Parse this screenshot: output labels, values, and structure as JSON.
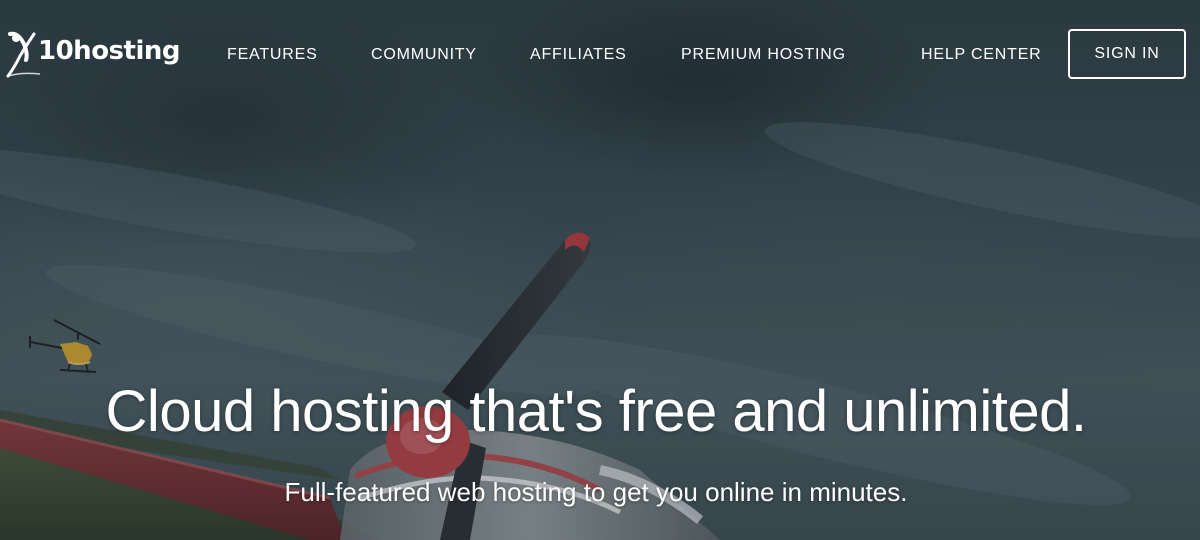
{
  "brand": {
    "name": "10hosting",
    "accent_color": "#ffffff"
  },
  "nav": {
    "items": [
      {
        "label": "FEATURES"
      },
      {
        "label": "COMMUNITY"
      },
      {
        "label": "AFFILIATES"
      },
      {
        "label": "PREMIUM HOSTING"
      },
      {
        "label": "HELP CENTER"
      }
    ],
    "signin_label": "SIGN IN"
  },
  "hero": {
    "headline": "Cloud hosting that's free and unlimited.",
    "subheadline": "Full-featured web hosting to get you online in minutes.",
    "background": "stormy-sky-airplane-propeller-helicopter"
  }
}
